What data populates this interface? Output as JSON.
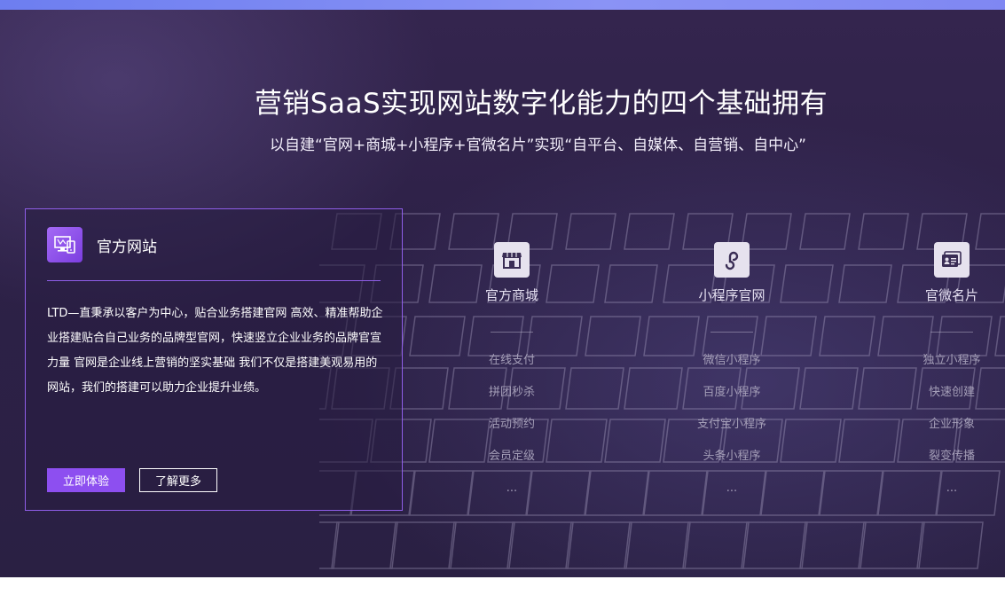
{
  "header": {
    "title": "营销SaaS实现网站数字化能力的四个基础拥有",
    "subtitle": "以自建“官网+商城+小程序+官微名片”实现“自平台、自媒体、自营销、自中心”"
  },
  "card": {
    "icon": "website-icon",
    "title": "官方网站",
    "text": "LTD—直秉承以客户为中心，贴合业务搭建官网 高效、精准帮助企业搭建贴合自己业务的品牌型官网，快速竖立企业业务的品牌官宣力量 官网是企业线上营销的坚实基础 我们不仅是搭建美观易用的网站，我们的搭建可以助力企业提升业绩。",
    "primary_button": "立即体验",
    "secondary_button": "了解更多"
  },
  "features": [
    {
      "icon": "shop-icon",
      "title": "官方商城",
      "items": [
        "在线支付",
        "拼团秒杀",
        "活动预约",
        "会员定级",
        "..."
      ]
    },
    {
      "icon": "mini-program-icon",
      "title": "小程序官网",
      "items": [
        "微信小程序",
        "百度小程序",
        "支付宝小程序",
        "头条小程序",
        "..."
      ]
    },
    {
      "icon": "business-card-icon",
      "title": "官微名片",
      "items": [
        "独立小程序",
        "快速创建",
        "企业形象",
        "裂变传播",
        "..."
      ]
    }
  ],
  "colors": {
    "accent": "#8d4ff0",
    "background": "#2d2147",
    "topbar": "#7f87f2"
  }
}
